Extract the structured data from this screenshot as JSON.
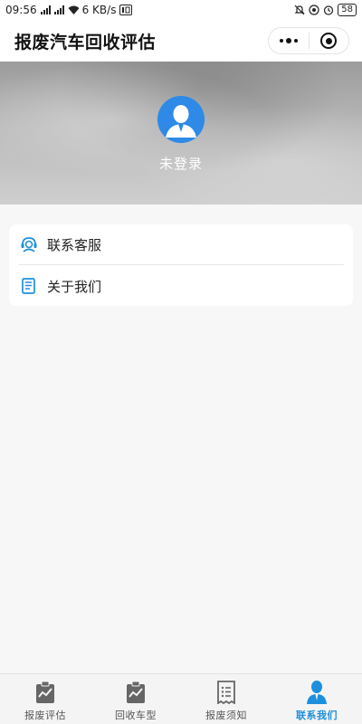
{
  "status_bar": {
    "time": "09:56",
    "net_speed": "6 KB/s",
    "battery": "58",
    "signal_tags": [
      "4G",
      "4G"
    ]
  },
  "title_bar": {
    "title": "报废汽车回收评估",
    "menu_icon": "more-dots-icon",
    "close_icon": "target-close-icon"
  },
  "profile": {
    "login_status": "未登录",
    "avatar_icon": "user-avatar-icon",
    "avatar_color": "#2e8ae6"
  },
  "menu": {
    "items": [
      {
        "label": "联系客服",
        "icon": "customer-service-icon"
      },
      {
        "label": "关于我们",
        "icon": "document-icon"
      }
    ],
    "icon_color": "#1e8fdc"
  },
  "tab_bar": {
    "tabs": [
      {
        "label": "报废评估",
        "icon": "clipboard-chart-icon",
        "active": false
      },
      {
        "label": "回收车型",
        "icon": "clipboard-chart-icon",
        "active": false
      },
      {
        "label": "报废须知",
        "icon": "receipt-list-icon",
        "active": false
      },
      {
        "label": "联系我们",
        "icon": "person-icon",
        "active": true
      }
    ],
    "active_color": "#1e8fdc",
    "inactive_color": "#555555"
  }
}
